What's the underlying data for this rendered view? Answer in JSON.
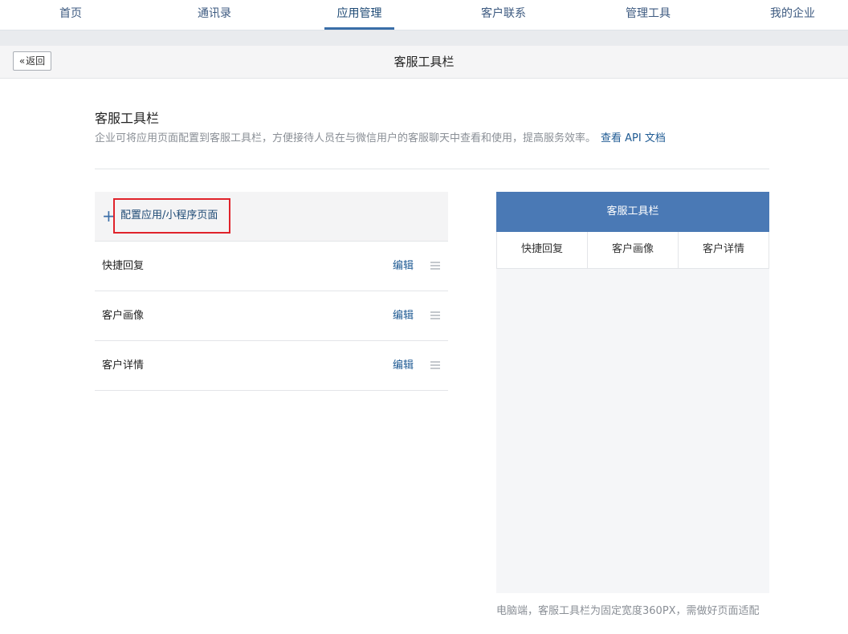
{
  "nav": {
    "items": [
      {
        "label": "首页"
      },
      {
        "label": "通讯录"
      },
      {
        "label": "应用管理",
        "active": true
      },
      {
        "label": "客户联系"
      },
      {
        "label": "管理工具"
      },
      {
        "label": "我的企业"
      }
    ]
  },
  "subheader": {
    "back_label": "返回",
    "back_icon": "double-chevron-left-icon",
    "title": "客服工具栏"
  },
  "section": {
    "title": "客服工具栏",
    "description": "企业可将应用页面配置到客服工具栏，方便接待人员在与微信用户的客服聊天中查看和使用，提高服务效率。",
    "link": "查看 API 文档"
  },
  "list": {
    "add_label": "配置应用/小程序页面",
    "add_icon": "plus-icon",
    "items": [
      {
        "name": "快捷回复",
        "edit": "编辑"
      },
      {
        "name": "客户画像",
        "edit": "编辑"
      },
      {
        "name": "客户详情",
        "edit": "编辑"
      }
    ]
  },
  "preview": {
    "header": "客服工具栏",
    "tabs": [
      "快捷回复",
      "客户画像",
      "客户详情"
    ],
    "note": "电脑端，客服工具栏为固定宽度360PX，需做好页面适配"
  },
  "colors": {
    "accent": "#3a6ea8",
    "preview_header": "#4a79b5",
    "highlight_border": "#e0232b",
    "link": "#1e5a93"
  }
}
